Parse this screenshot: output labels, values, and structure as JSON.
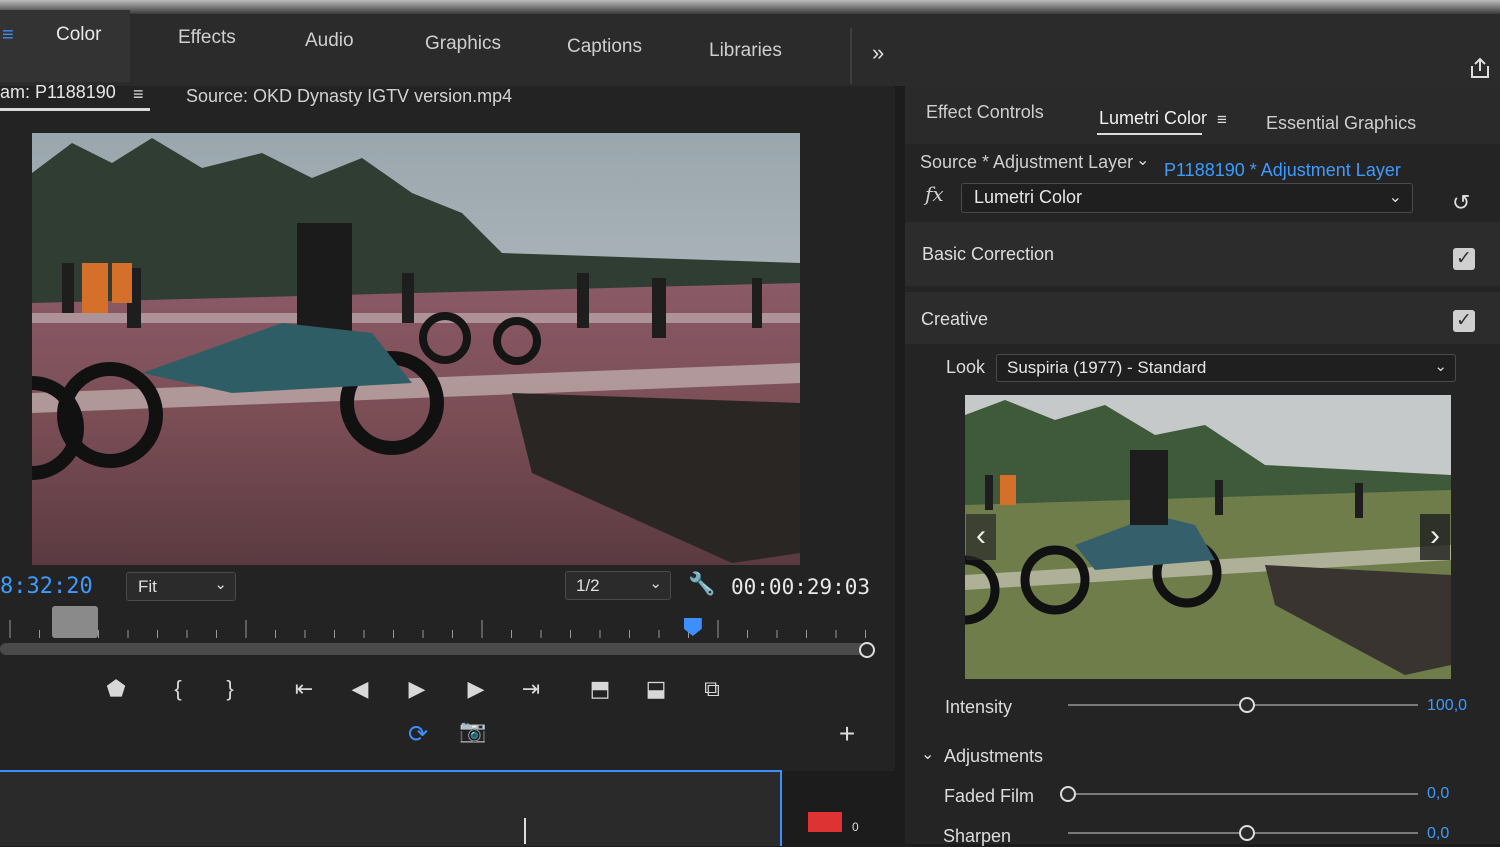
{
  "workspace_tabs": [
    {
      "label": "Color",
      "active": true
    },
    {
      "label": "Effects"
    },
    {
      "label": "Audio"
    },
    {
      "label": "Graphics"
    },
    {
      "label": "Captions"
    },
    {
      "label": "Libraries"
    }
  ],
  "workspace_more": "»",
  "source_monitor": {
    "tab_label": "am: P1188190",
    "menu_icon": "≡",
    "title": "Source: OKD Dynasty IGTV version.mp4",
    "timecode_left": "8:32:20",
    "zoom_select": "Fit",
    "resolution_select": "1/2",
    "timecode_right": "00:00:29:03",
    "playhead_fraction": 0.8,
    "meter_value": "0"
  },
  "right_panel": {
    "tabs": [
      "Effect Controls",
      "Lumetri Color",
      "Essential Graphics"
    ],
    "menu_icon": "≡",
    "source_layer": "Source * Adjustment Layer",
    "sequence_layer": "P1188190 * Adjustment Layer",
    "fx_label": "fx",
    "effect_select": "Lumetri Color",
    "sections": {
      "basic": {
        "label": "Basic Correction",
        "checked": true
      },
      "creative": {
        "label": "Creative",
        "checked": true
      }
    },
    "look_label": "Look",
    "look_select": "Suspiria (1977) - Standard",
    "intensity": {
      "label": "Intensity",
      "value": "100,0",
      "fraction": 0.51
    },
    "adjustments_label": "Adjustments",
    "faded_film": {
      "label": "Faded Film",
      "value": "0,0",
      "fraction": 0.0
    },
    "sharpen": {
      "label": "Sharpen",
      "value": "0,0",
      "fraction": 0.51
    }
  }
}
